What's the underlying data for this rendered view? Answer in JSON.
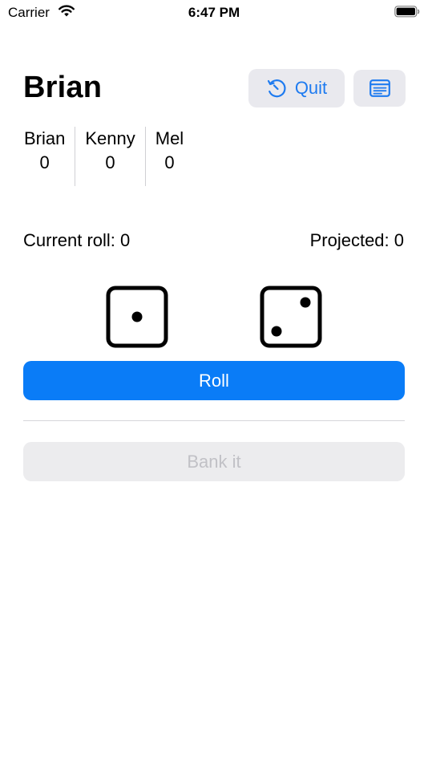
{
  "status_bar": {
    "carrier": "Carrier",
    "time": "6:47 PM"
  },
  "header": {
    "current_player": "Brian",
    "quit_label": "Quit"
  },
  "scoreboard": {
    "players": [
      {
        "name": "Brian",
        "score": "0"
      },
      {
        "name": "Kenny",
        "score": "0"
      },
      {
        "name": "Mel",
        "score": "0"
      }
    ]
  },
  "roll_info": {
    "current_roll": "Current roll: 0",
    "projected": "Projected: 0"
  },
  "dice": [
    1,
    2
  ],
  "actions": {
    "roll_label": "Roll",
    "bank_label": "Bank it",
    "bank_enabled": false
  },
  "colors": {
    "accent": "#0a7cf7",
    "button_bg": "#e9e9ee",
    "disabled_text": "#c1c1c6"
  },
  "icons": {
    "quit": "counterclockwise-arrow-icon",
    "notes": "note-text-icon"
  }
}
